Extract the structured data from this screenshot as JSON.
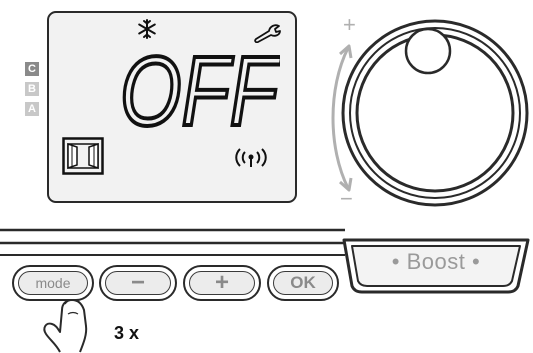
{
  "display": {
    "status_text": "OFF",
    "level_indicators": [
      "C",
      "B",
      "A"
    ],
    "active_level": "C",
    "icons": {
      "frost": "snowflake-icon",
      "settings": "wrench-icon",
      "window": "window-open-icon",
      "wireless": "wireless-signal-icon"
    }
  },
  "dial": {
    "plus_label": "+",
    "minus_label": "−"
  },
  "controls": {
    "mode_label": "mode",
    "minus_label": "−",
    "plus_label": "+",
    "ok_label": "OK",
    "boost_label": "Boost"
  },
  "instruction": {
    "press_count": "3 x"
  },
  "colors": {
    "outline": "#2a2a2a",
    "button_fill": "#ececec",
    "lcd_background": "#f2f2f2",
    "active_level": "#8a8a8a",
    "inactive_level": "#c8c8c8",
    "label_gray": "#9a9a9a"
  }
}
